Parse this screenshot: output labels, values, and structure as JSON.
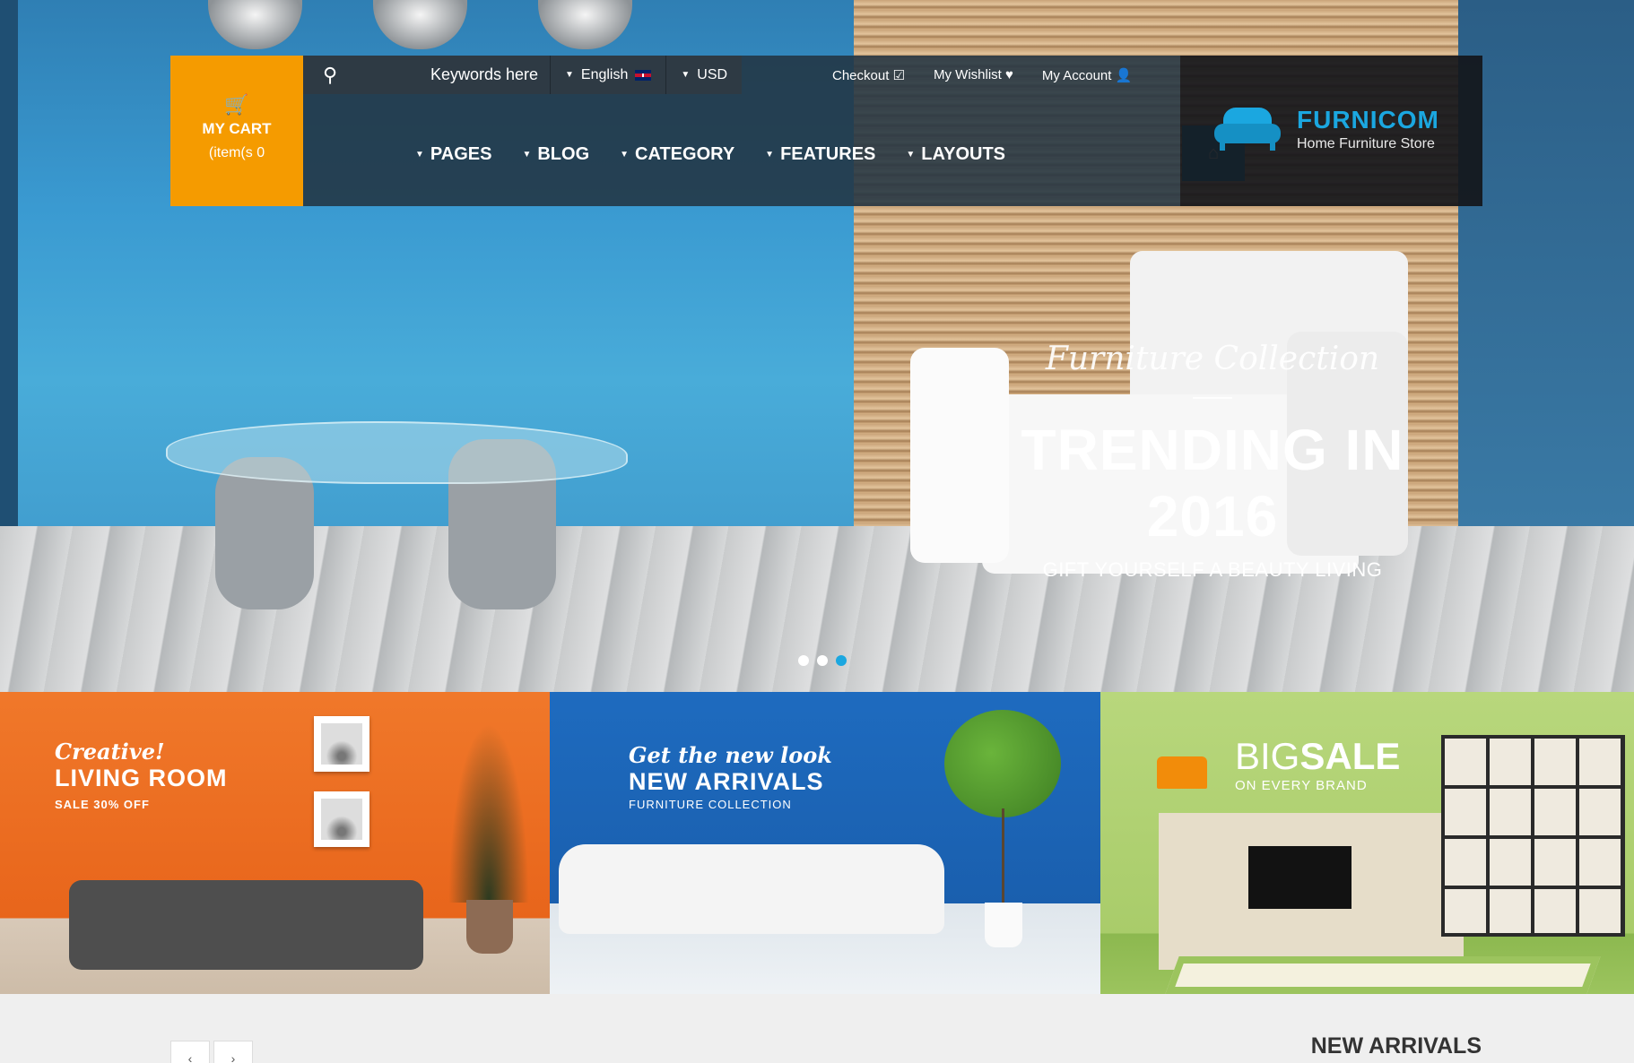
{
  "header": {
    "cart": {
      "icon": "shopping-cart-icon",
      "title": "MY CART",
      "count": "(item(s 0"
    },
    "search": {
      "icon": "search-icon",
      "placeholder": "Keywords here"
    },
    "language": {
      "label": "English",
      "icon": "uk-flag-icon"
    },
    "currency": {
      "label": "USD"
    },
    "links": [
      {
        "label": "Checkout",
        "icon": "checkout-check-icon",
        "glyph": "☑"
      },
      {
        "label": "My Wishlist",
        "icon": "heart-icon",
        "glyph": "♥"
      },
      {
        "label": "My Account",
        "icon": "user-icon",
        "glyph": "👤"
      }
    ],
    "nav": [
      {
        "label": "PAGES"
      },
      {
        "label": "BLOG"
      },
      {
        "label": "CATEGORY"
      },
      {
        "label": "FEATURES"
      },
      {
        "label": "LAYOUTS"
      }
    ],
    "home_icon": "home-icon",
    "logo": {
      "name": "FURNICOM",
      "tagline": "Home Furniture Store",
      "icon": "sofa-logo-icon"
    }
  },
  "hero": {
    "subtitle": "Furniture Collection",
    "title": "TRENDING IN 2016",
    "caption": "GIFT YOURSELF A BEAUTY LIVING",
    "slides": 3,
    "active_slide": 3
  },
  "banners": [
    {
      "script": "Creative!",
      "title": "LIVING ROOM",
      "small": "SALE 30% OFF"
    },
    {
      "script": "Get the new look",
      "title": "NEW ARRIVALS",
      "small": "FURNITURE COLLECTION"
    },
    {
      "big_thin": "BIG",
      "big_bold": "SALE",
      "small": "ON EVERY BRAND"
    }
  ],
  "bottom": {
    "prev": "‹",
    "next": "›",
    "title": "NEW ARRIVALS"
  },
  "colors": {
    "accent": "#1ba7e0",
    "cart": "#f59b00",
    "nav_bg": "#223442"
  }
}
